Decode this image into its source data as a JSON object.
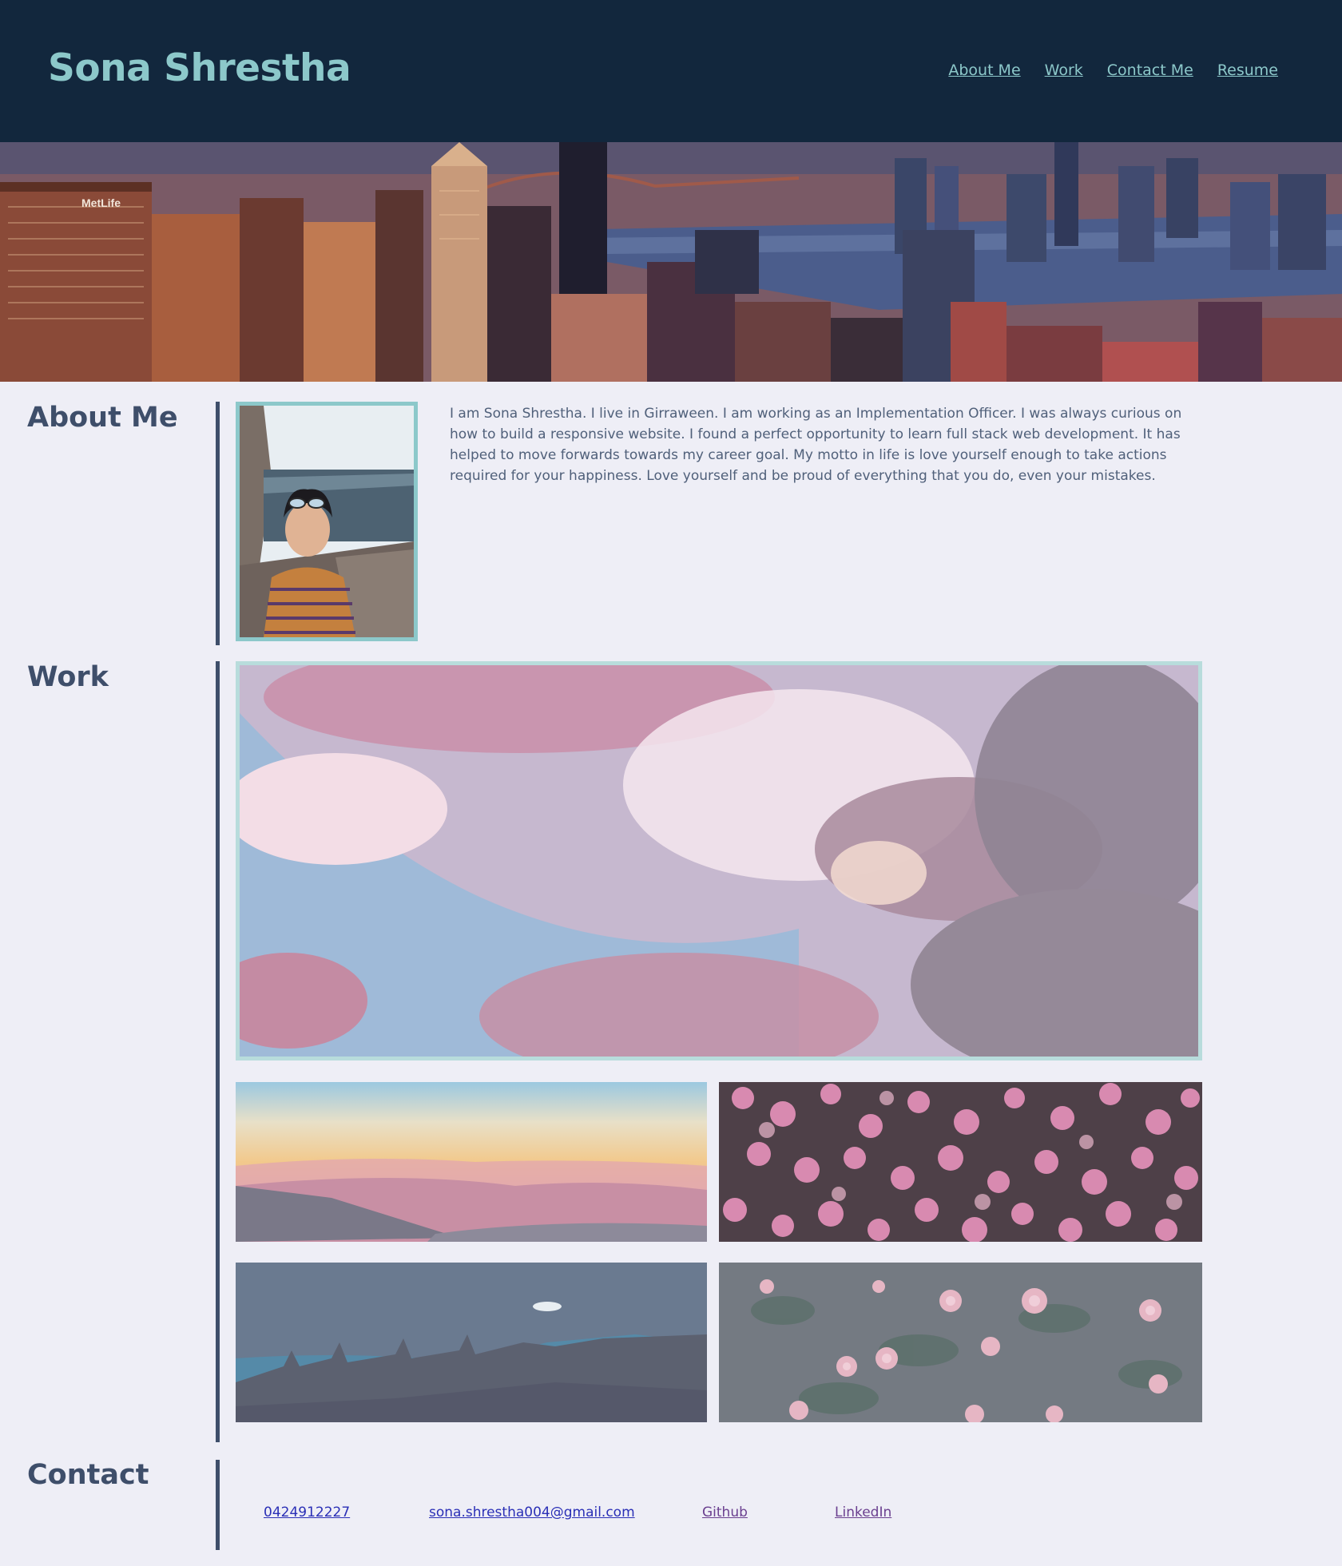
{
  "header": {
    "title": "Sona Shrestha",
    "nav": [
      "About Me",
      "Work",
      "Contact Me",
      "Resume"
    ]
  },
  "hero": {
    "image": "city-skyline-photo"
  },
  "about": {
    "heading": "About Me",
    "portrait": "profile-photo",
    "text": "I am Sona Shrestha. I live in Girraween. I am working as an Implementation Officer. I was always curious on how to build a responsive website. I found a perfect opportunity to learn full stack web development. It has helped to move forwards towards my career goal. My motto in life is love yourself enough to take actions required for your happiness. Love yourself and be proud of everything that you do, even your mistakes."
  },
  "work": {
    "heading": "Work",
    "items": [
      "pink-clouds-photo",
      "sunset-mountains-photo",
      "pink-flowers-photo",
      "night-forest-photo",
      "roses-photo"
    ]
  },
  "contact": {
    "heading": "Contact",
    "phone": "0424912227",
    "email": "sona.shrestha004@gmail.com",
    "github": "Github",
    "linkedin": "LinkedIn"
  },
  "colors": {
    "header_bg": "#12273d",
    "accent": "#8cc8ca",
    "page_bg": "#eeeef6",
    "heading": "#3e4e6a"
  }
}
